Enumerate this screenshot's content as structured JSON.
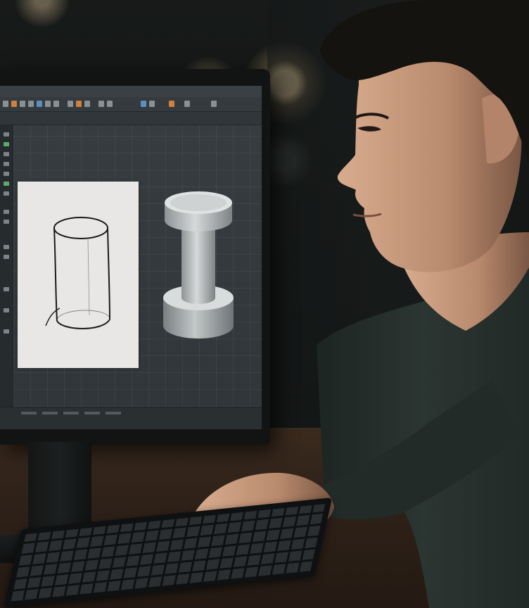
{
  "scene": {
    "description_visible_text": "",
    "colors": {
      "screen_bg": "#2b3032",
      "viewport_bg": "#363c3f",
      "paper": "#e8e7e5",
      "model": "#c9cccd",
      "desk": "#2e2118",
      "sweater": "#27302c",
      "skin": "#c99b7e",
      "hair": "#15130f",
      "lamp_glow": "#ffe2aa"
    }
  },
  "icons": {
    "toolbar": [
      "tool-icon"
    ],
    "left_panel": [
      "tool-icon"
    ]
  }
}
